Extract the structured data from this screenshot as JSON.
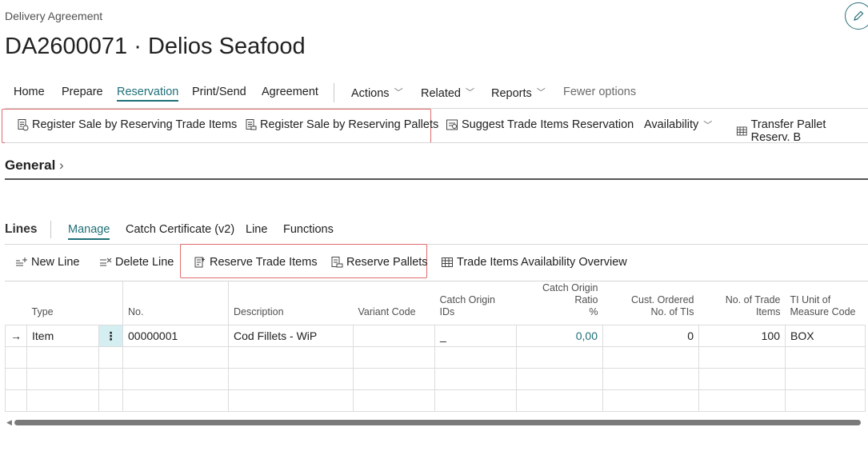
{
  "page": {
    "breadcrumb": "Delivery Agreement",
    "title": "DA2600071 · Delios Seafood"
  },
  "menu": {
    "items": [
      "Home",
      "Prepare",
      "Reservation",
      "Print/Send",
      "Agreement"
    ],
    "active": "Reservation",
    "dropdowns": [
      "Actions",
      "Related",
      "Reports"
    ],
    "fewer": "Fewer options"
  },
  "actions": {
    "register_trade_items": "Register Sale by Reserving Trade Items",
    "register_pallets": "Register Sale by Reserving Pallets",
    "suggest": "Suggest Trade Items Reservation",
    "availability": "Availability",
    "transfer": "Transfer Pallet Reserv. B"
  },
  "general": {
    "title": "General"
  },
  "lines": {
    "label": "Lines",
    "tabs": [
      "Manage",
      "Catch Certificate (v2)",
      "Line",
      "Functions"
    ],
    "active_tab": "Manage",
    "actions": {
      "new_line": "New Line",
      "delete_line": "Delete Line",
      "reserve_trade_items": "Reserve Trade Items",
      "reserve_pallets": "Reserve Pallets",
      "availability_overview": "Trade Items Availability Overview"
    },
    "columns": {
      "type": "Type",
      "no": "No.",
      "description": "Description",
      "variant": "Variant Code",
      "catch_origin_ids_1": "Catch Origin",
      "catch_origin_ids_2": "IDs",
      "ratio_1": "Catch Origin Ratio",
      "ratio_2": "%",
      "cust_ordered_1": "Cust. Ordered",
      "cust_ordered_2": "No. of TIs",
      "no_trade_1": "No. of Trade",
      "no_trade_2": "Items",
      "ti_uom_1": "TI Unit of",
      "ti_uom_2": "Measure Code"
    },
    "rows": [
      {
        "arrow": "→",
        "type": "Item",
        "menu": "⋮",
        "no": "00000001",
        "description": "Cod Fillets - WiP",
        "variant": "",
        "catch_ids": "_",
        "ratio": "0,00",
        "cust_ordered": "0",
        "no_trade": "100",
        "uom": "BOX"
      }
    ]
  },
  "colors": {
    "accent": "#1f6f78",
    "highlight": "#e06c6c"
  }
}
